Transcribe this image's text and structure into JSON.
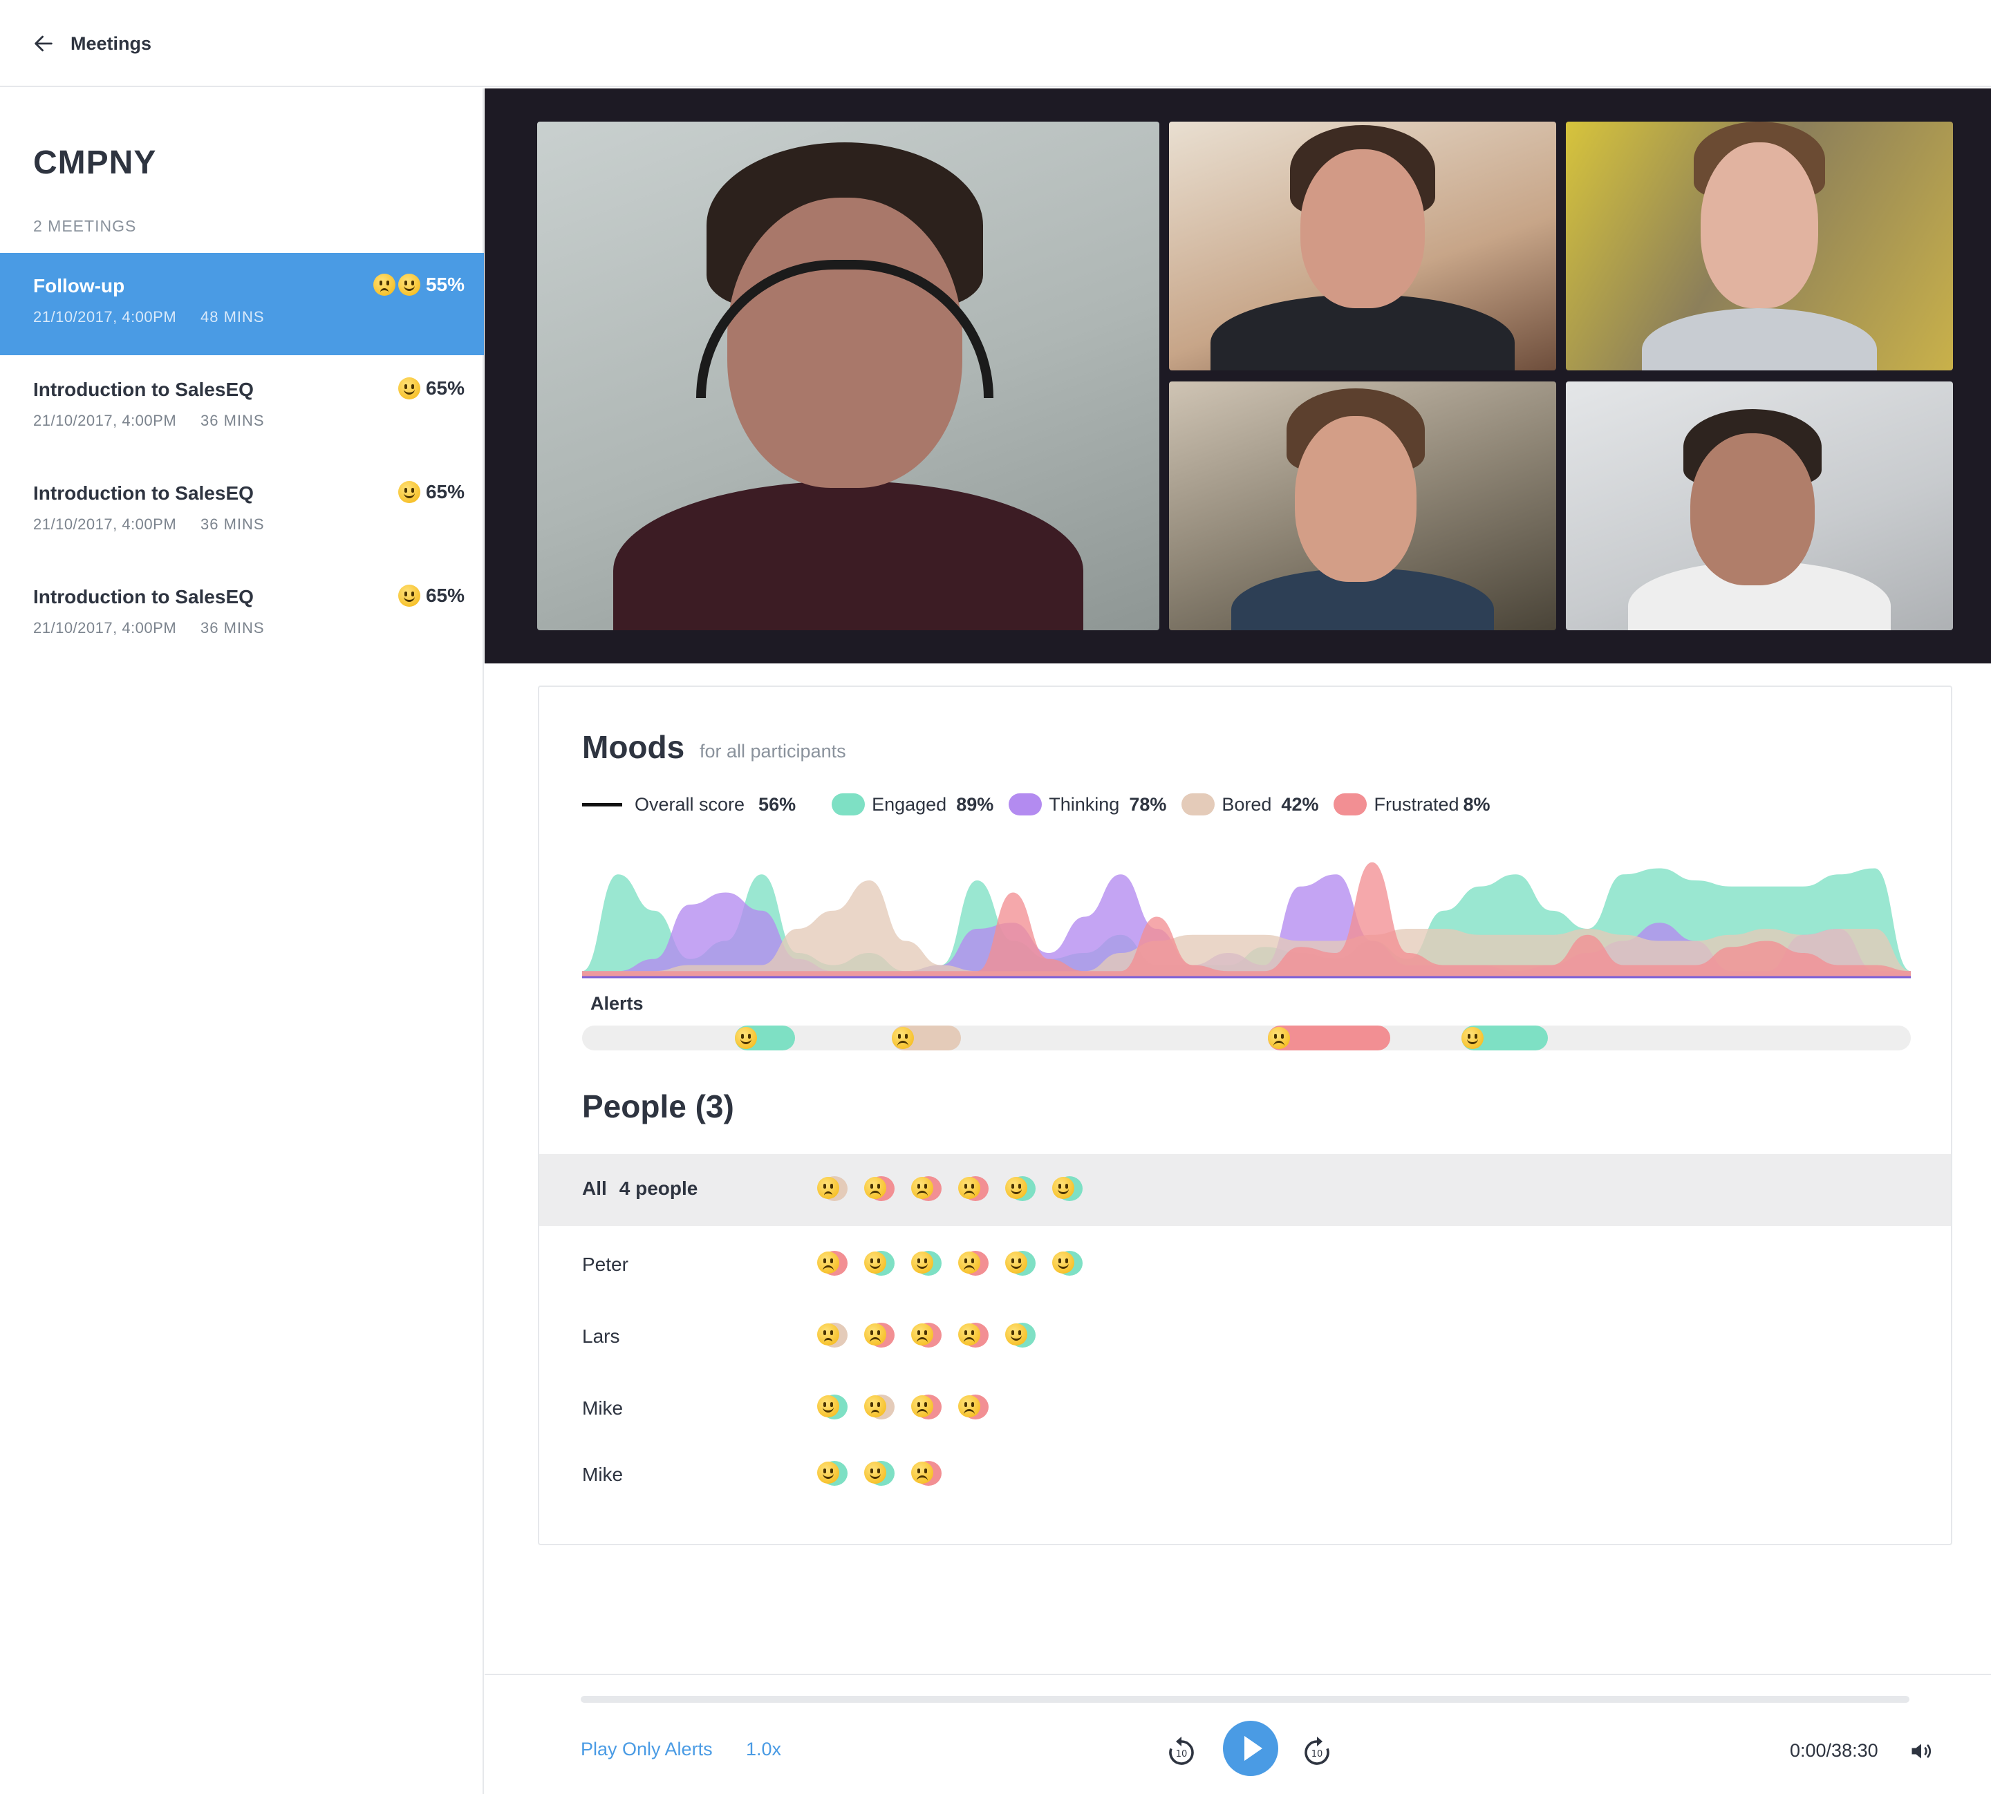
{
  "header": {
    "back_label": "Meetings"
  },
  "sidebar": {
    "company": "CMPNY",
    "meeting_count": "2 MEETINGS",
    "meetings": [
      {
        "title": "Follow-up",
        "date": "21/10/2017, 4:00PM",
        "duration": "48 MINS",
        "score": "55%",
        "emojis": [
          "thinking",
          "smile"
        ],
        "active": true
      },
      {
        "title": "Introduction to SalesEQ",
        "date": "21/10/2017, 4:00PM",
        "duration": "36 MINS",
        "score": "65%",
        "emojis": [
          "smile"
        ],
        "active": false
      },
      {
        "title": "Introduction to SalesEQ",
        "date": "21/10/2017, 4:00PM",
        "duration": "36 MINS",
        "score": "65%",
        "emojis": [
          "smile"
        ],
        "active": false
      },
      {
        "title": "Introduction to SalesEQ",
        "date": "21/10/2017, 4:00PM",
        "duration": "36 MINS",
        "score": "65%",
        "emojis": [
          "smile"
        ],
        "active": false
      }
    ]
  },
  "moods": {
    "title": "Moods",
    "subtitle": "for all participants",
    "legend": [
      {
        "key": "overall",
        "label": "Overall score",
        "value": "56%",
        "color": "#111111"
      },
      {
        "key": "engaged",
        "label": "Engaged",
        "value": "89%",
        "color": "#7ee0c4"
      },
      {
        "key": "thinking",
        "label": "Thinking",
        "value": "78%",
        "color": "#b38bf0"
      },
      {
        "key": "bored",
        "label": "Bored",
        "value": "42%",
        "color": "#e4cbb9"
      },
      {
        "key": "frustrated",
        "label": "Frustrated",
        "value": "8%",
        "color": "#f28f93"
      }
    ],
    "alerts_label": "Alerts",
    "alerts": [
      {
        "mood": "engaged",
        "emoji": "smile",
        "start": 0.115,
        "end": 0.16
      },
      {
        "mood": "bored",
        "emoji": "sleepy",
        "start": 0.233,
        "end": 0.285
      },
      {
        "mood": "frustrated",
        "emoji": "frown",
        "start": 0.516,
        "end": 0.608
      },
      {
        "mood": "engaged",
        "emoji": "smile",
        "start": 0.662,
        "end": 0.727
      }
    ]
  },
  "chart_data": {
    "type": "area",
    "series": [
      {
        "name": "Engaged",
        "color": "#7ee0c4",
        "values": [
          0.05,
          0.85,
          0.55,
          0.15,
          0.3,
          0.85,
          0.2,
          0.1,
          0.2,
          0.05,
          0.1,
          0.8,
          0.3,
          0.15,
          0.2,
          0.35,
          0.1,
          0.1,
          0.1,
          0.25,
          0.2,
          0.15,
          0.3,
          0.15,
          0.55,
          0.75,
          0.85,
          0.55,
          0.4,
          0.85,
          0.9,
          0.8,
          0.75,
          0.75,
          0.75,
          0.85,
          0.9,
          0.05
        ]
      },
      {
        "name": "Thinking",
        "color": "#b38bf0",
        "values": [
          0.05,
          0.05,
          0.15,
          0.6,
          0.7,
          0.55,
          0.15,
          0.05,
          0.05,
          0.05,
          0.1,
          0.4,
          0.45,
          0.2,
          0.5,
          0.85,
          0.4,
          0.1,
          0.2,
          0.1,
          0.75,
          0.85,
          0.3,
          0.1,
          0.1,
          0.1,
          0.05,
          0.1,
          0.2,
          0.3,
          0.45,
          0.3,
          0.05,
          0.05,
          0.35,
          0.4,
          0.05,
          0.05
        ]
      },
      {
        "name": "Bored",
        "color": "#e4cbb9",
        "values": [
          0.05,
          0.05,
          0.05,
          0.1,
          0.1,
          0.1,
          0.4,
          0.55,
          0.8,
          0.3,
          0.1,
          0.05,
          0.05,
          0.05,
          0.05,
          0.2,
          0.3,
          0.35,
          0.35,
          0.35,
          0.3,
          0.3,
          0.35,
          0.4,
          0.4,
          0.35,
          0.35,
          0.35,
          0.4,
          0.35,
          0.3,
          0.3,
          0.35,
          0.4,
          0.35,
          0.4,
          0.4,
          0.05
        ]
      },
      {
        "name": "Frustrated",
        "color": "#f28f93",
        "values": [
          0.05,
          0.05,
          0.05,
          0.05,
          0.05,
          0.05,
          0.05,
          0.05,
          0.05,
          0.05,
          0.05,
          0.05,
          0.7,
          0.15,
          0.05,
          0.05,
          0.5,
          0.1,
          0.05,
          0.05,
          0.25,
          0.2,
          0.95,
          0.2,
          0.1,
          0.1,
          0.1,
          0.1,
          0.35,
          0.1,
          0.1,
          0.1,
          0.25,
          0.3,
          0.2,
          0.1,
          0.1,
          0.05
        ]
      }
    ],
    "ylim": [
      0,
      1
    ]
  },
  "people": {
    "title": "People (3)",
    "rows": [
      {
        "name": "All",
        "extra": "4 people",
        "all": true,
        "emojis": [
          "thinking",
          "frown",
          "frown",
          "frown",
          "smile",
          "smile"
        ]
      },
      {
        "name": "Peter",
        "emojis": [
          "frown",
          "smile",
          "smile",
          "frown",
          "smile",
          "smile"
        ]
      },
      {
        "name": "Lars",
        "emojis": [
          "thinking",
          "frown",
          "frown",
          "frown",
          "smile"
        ]
      },
      {
        "name": "Mike",
        "emojis": [
          "smile",
          "thinking",
          "frown",
          "frown"
        ]
      },
      {
        "name": "Mike",
        "emojis": [
          "smile",
          "smile",
          "frown"
        ]
      }
    ]
  },
  "player": {
    "play_only_alerts": "Play Only Alerts",
    "speed": "1.0x",
    "time": "0:00/38:30",
    "progress": 0
  }
}
